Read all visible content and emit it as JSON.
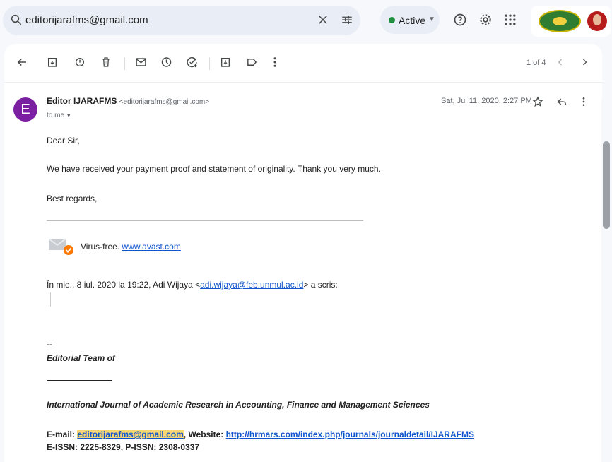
{
  "search": {
    "query": "editorijarafms@gmail.com"
  },
  "status": {
    "label": "Active"
  },
  "pager": {
    "text": "1 of 4"
  },
  "email": {
    "avatar_letter": "E",
    "sender_name": "Editor IJARAFMS",
    "sender_address": "<editorijarafms@gmail.com>",
    "to": "to me",
    "date": "Sat, Jul 11, 2020, 2:27 PM",
    "greeting": "Dear Sir,",
    "line1": "We have received your payment proof and statement of originality. Thank you very much.",
    "signoff": "Best regards,",
    "virus_text": "Virus-free.",
    "virus_link": "www.avast.com",
    "quote_intro_pre": "În mie., 8 iul. 2020 la 19:22, Adi Wijaya <",
    "quote_email": "adi.wijaya@feb.unmul.ac.id",
    "quote_intro_post": "> a scris:",
    "sig_dash": "--",
    "sig_team": "Editorial Team of",
    "sig_journal": "International Journal of Academic Research in Accounting, Finance and Management Sciences",
    "sig_email_label": "E-mail:",
    "sig_email": "editorijarafms@gmail.com",
    "sig_website_label": ", Website:",
    "sig_website": "http://hrmars.com/index.php/journals/journaldetail/IJARAFMS",
    "sig_issn": "E-ISSN: 2225-8329, P-ISSN: 2308-0337"
  },
  "colors": {
    "accent_link": "#1155cc",
    "avatar": "#7b1fa2",
    "highlight": "#f7d774",
    "status_dot": "#1e8e3e"
  }
}
